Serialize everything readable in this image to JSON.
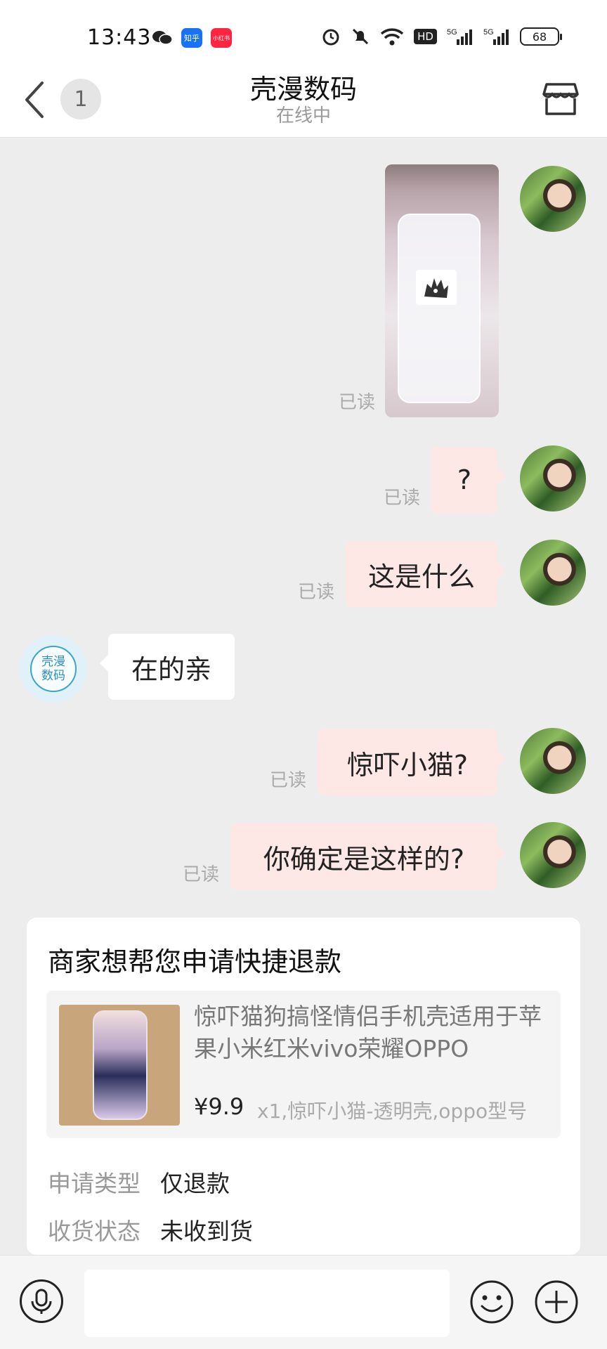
{
  "status_bar": {
    "time": "13:43",
    "apps": [
      {
        "name": "wechat-icon",
        "label": ""
      },
      {
        "name": "zhihu-icon",
        "label": "知乎"
      },
      {
        "name": "xiaohongshu-icon",
        "label": "小红书"
      }
    ],
    "battery": "68",
    "hd": "HD"
  },
  "header": {
    "unread_count": "1",
    "title": "壳漫数码",
    "subtitle": "在线中"
  },
  "messages": {
    "read_label": "已读",
    "m1": "?",
    "m2": "这是什么",
    "shop_reply": "在的亲",
    "m3": "惊吓小猫?",
    "m4": "你确定是这样的?"
  },
  "shop_avatar": {
    "line1": "壳漫",
    "line2": "数码"
  },
  "refund_card": {
    "title": "商家想帮您申请快捷退款",
    "product_title": "惊吓猫狗搞怪情侣手机壳适用于苹果小米红米vivo荣耀OPPO",
    "price": "¥9.9",
    "spec": "x1,惊吓小猫-透明壳,oppo型号",
    "rows": [
      {
        "label": "申请类型",
        "value": "仅退款"
      },
      {
        "label": "收货状态",
        "value": "未收到货"
      }
    ]
  },
  "input": {
    "placeholder": ""
  }
}
